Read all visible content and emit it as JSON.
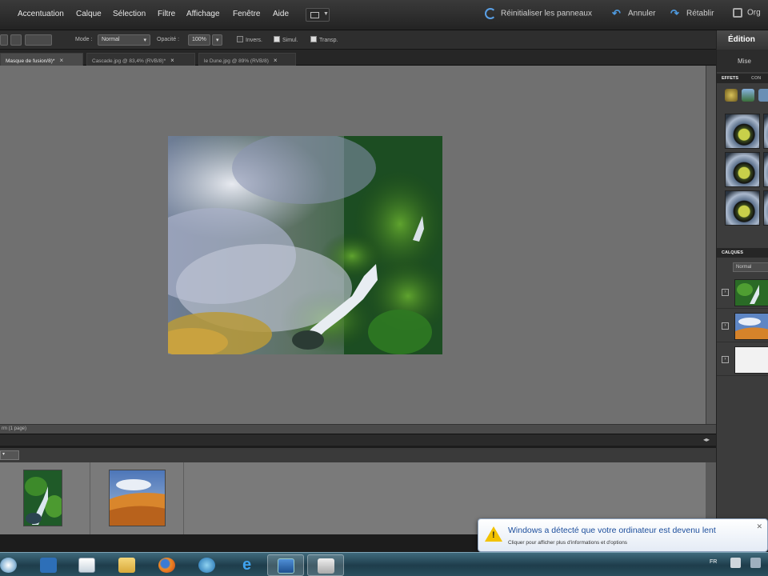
{
  "menubar": {
    "items": [
      "Accentuation",
      "Calque",
      "Sélection",
      "Filtre",
      "Affichage",
      "Fenêtre",
      "Aide"
    ],
    "reset_panels": "Réinitialiser les panneaux",
    "undo": "Annuler",
    "redo": "Rétablir",
    "organizer": "Org"
  },
  "options": {
    "mode_label": "Mode :",
    "mode_value": "Normal",
    "opacity_label": "Opacité :",
    "opacity_value": "100%",
    "check_inverse": "Invers.",
    "check_simulate": "Simul.",
    "check_transp": "Transp."
  },
  "tabs": [
    {
      "label": "Masque de fusion/8)*",
      "active": true
    },
    {
      "label": "Cascade.jpg @ 83,4% (RVB/8)*",
      "active": false
    },
    {
      "label": "le Dune.jpg @ 89% (RVB/8)",
      "active": false
    }
  ],
  "status": "rm (1 page)",
  "right_panel": {
    "mode": "Édition",
    "quick": "Mise",
    "effects_tab": "EFFETS",
    "effects_tab2": "CON",
    "layers_tab": "CALQUES",
    "layers_mode": "Normal"
  },
  "notification": {
    "title": "Windows a détecté que votre ordinateur est devenu lent",
    "subtitle": "Cliquer pour afficher plus d'informations et d'options"
  },
  "tray": {
    "lang": "FR"
  },
  "colors": {
    "accent_blue": "#4f9be0",
    "canvas_gray": "#707070",
    "bin_gray": "#7a7a7a",
    "warning_yellow": "#f2c200"
  }
}
